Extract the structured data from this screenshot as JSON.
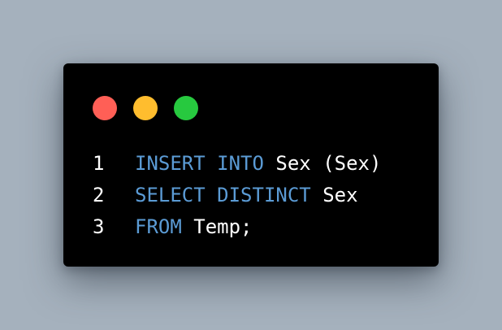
{
  "colors": {
    "background": "#a5b1bd",
    "window": "#000000",
    "keyword": "#5b9bd5",
    "text": "#ffffff",
    "dot_red": "#ff5f56",
    "dot_yellow": "#ffbd2e",
    "dot_green": "#27c93f"
  },
  "window_controls": [
    {
      "name": "close",
      "color": "#ff5f56"
    },
    {
      "name": "minimize",
      "color": "#ffbd2e"
    },
    {
      "name": "maximize",
      "color": "#27c93f"
    }
  ],
  "code": {
    "language": "SQL",
    "lines": [
      {
        "number": "1",
        "tokens": [
          {
            "type": "keyword",
            "text": "INSERT INTO"
          },
          {
            "type": "text",
            "text": " Sex (Sex)"
          }
        ]
      },
      {
        "number": "2",
        "tokens": [
          {
            "type": "keyword",
            "text": "SELECT DISTINCT"
          },
          {
            "type": "text",
            "text": " Sex"
          }
        ]
      },
      {
        "number": "3",
        "tokens": [
          {
            "type": "keyword",
            "text": "FROM"
          },
          {
            "type": "text",
            "text": " Temp;"
          }
        ]
      }
    ]
  }
}
